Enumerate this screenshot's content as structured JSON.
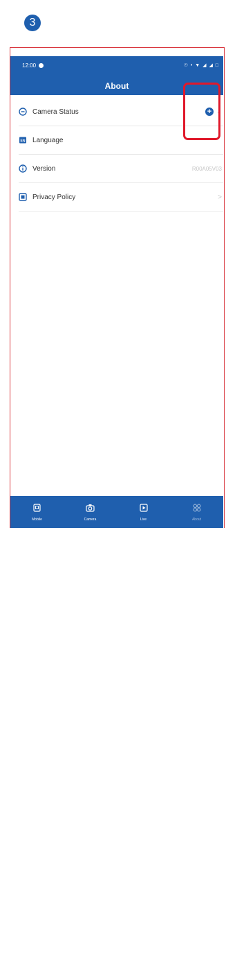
{
  "step": {
    "number": "3"
  },
  "status_bar": {
    "time": "12:00",
    "icons": "☉ • ▼ ◢ ◢ □"
  },
  "header": {
    "title": "About"
  },
  "menu": [
    {
      "label": "Camera Status",
      "icon": "camera-status-icon",
      "value": "",
      "trailing": ""
    },
    {
      "label": "Language",
      "icon": "language-icon",
      "value": "",
      "trailing": ""
    },
    {
      "label": "Version",
      "icon": "info-icon",
      "value": "R00A05V03",
      "trailing": ""
    },
    {
      "label": "Privacy Policy",
      "icon": "privacy-policy-icon",
      "value": "",
      "trailing": ">"
    }
  ],
  "tabs": [
    {
      "label": "Mobile",
      "icon": "mobile-icon"
    },
    {
      "label": "Camera",
      "icon": "camera-icon"
    },
    {
      "label": "Live",
      "icon": "live-icon"
    },
    {
      "label": "About",
      "icon": "about-icon"
    }
  ],
  "colors": {
    "brand_blue": "#1f5fae",
    "highlight_red": "#e0192b"
  }
}
